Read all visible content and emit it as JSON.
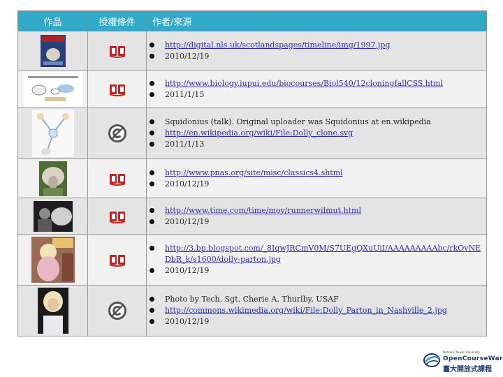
{
  "header": {
    "col1": "作品",
    "col2": "授權條件",
    "col3": "作者/來源"
  },
  "rows": [
    {
      "license": "copyright",
      "thumb": "nature-cover",
      "items": [
        {
          "text": "http://digital.nls.uk/scotlandspages/timeline/img/1997.jpg",
          "link": true
        },
        {
          "text": "2010/12/19",
          "link": false
        }
      ]
    },
    {
      "license": "copyright",
      "thumb": "cloning-diagram",
      "items": [
        {
          "text": "http://www.biology.iupui.edu/biocourses/Biol540/12cloningfallCSS.html",
          "link": true
        },
        {
          "text": "2011/1/15",
          "link": false
        }
      ]
    },
    {
      "license": "public-domain",
      "thumb": "dolly-clone-svg",
      "items": [
        {
          "text": "Squidonius (talk). Original uploader was Squidonius at en.wikipedia",
          "link": false
        },
        {
          "text": "http://en.wikipedia.org/wiki/File:Dolly_clone.svg",
          "link": true
        },
        {
          "text": "2011/1/13",
          "link": false
        }
      ]
    },
    {
      "license": "copyright",
      "thumb": "sheep-photo",
      "items": [
        {
          "text": "http://www.pnas.org/site/misc/classics4.shtml",
          "link": true
        },
        {
          "text": "2010/12/19",
          "link": false
        }
      ]
    },
    {
      "license": "copyright",
      "thumb": "wilmut-photo",
      "items": [
        {
          "text": "http://www.time.com/time/moy/runnerwilmut.html",
          "link": true
        },
        {
          "text": "2010/12/19",
          "link": false
        }
      ]
    },
    {
      "license": "copyright",
      "thumb": "dolly-parton-poster",
      "items": [
        {
          "text": "http://3.bp.blogspot.com/_8IqwJRCmV0M/S7UEgQXuUiI/AAAAAAAAAbc/rkOvNEDbR_k/s1600/dolly-parton.jpg",
          "link": true
        },
        {
          "text": "2010/12/19",
          "link": false
        }
      ]
    },
    {
      "license": "public-domain",
      "thumb": "dolly-parton-photo",
      "items": [
        {
          "text": "Photo by Tech. Sgt. Cherie A. Thurlby, USAF",
          "link": false
        },
        {
          "text": "http://commons.wikimedia.org/wiki/File:Dolly_Parton_in_Nashville_2.jpg",
          "link": true
        },
        {
          "text": "2010/12/19",
          "link": false
        }
      ]
    }
  ],
  "logo": {
    "line1": "National Taiwan University",
    "line2": "OpenCourseWare",
    "line3": "臺大開放式課程"
  },
  "colors": {
    "header": "#31a9c9",
    "copyright_icon": "#cc1f1f",
    "pd_icon": "#555555",
    "link": "#2b2bb5"
  }
}
